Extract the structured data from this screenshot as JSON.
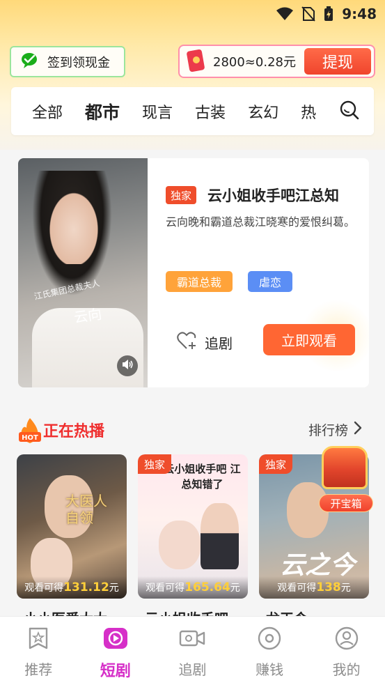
{
  "status_bar": {
    "time": "9:48"
  },
  "checkin": {
    "label": "签到领现金",
    "icon": "wechat-icon"
  },
  "balance": {
    "amount": "2800≈0.28元",
    "withdraw_label": "提现",
    "icon": "red-envelope-icon"
  },
  "category_tabs": [
    {
      "label": "全部",
      "active": false
    },
    {
      "label": "都市",
      "active": true
    },
    {
      "label": "现言",
      "active": false
    },
    {
      "label": "古装",
      "active": false
    },
    {
      "label": "玄幻",
      "active": false
    },
    {
      "label": "热",
      "active": false
    }
  ],
  "featured": {
    "badge": "独家",
    "title": "云小姐收手吧江总知",
    "description": "云向晚和霸道总裁江晓寒的爱恨纠葛。",
    "tags": [
      "霸道总裁",
      "虐恋"
    ],
    "poster_caption_small": "江氏集团总裁夫人",
    "poster_caption_name": "云向",
    "follow_label": "追剧",
    "watch_label": "立即观看",
    "colors": {
      "badge": "#ef4d2b",
      "tag1": "#ffa33a",
      "tag2": "#5b8ef5",
      "watch": "#ff6633"
    }
  },
  "hot_section": {
    "title": "正在热播",
    "rank_label": "排行榜",
    "hot_badge": "HOT",
    "treasure_label": "开宝箱",
    "cards": [
      {
        "badge": "",
        "earn_prefix": "观看可得",
        "earn_value": "131.12",
        "earn_suffix": "元",
        "poster_text": "大医人自领",
        "partial_title": "小小医爱大大"
      },
      {
        "badge": "独家",
        "earn_prefix": "观看可得",
        "earn_value": "165.64",
        "earn_suffix": "元",
        "poster_text": "云小姐收手吧 江总知错了",
        "partial_title": "云小姐收手吧"
      },
      {
        "badge": "独家",
        "earn_prefix": "观看可得",
        "earn_value": "138",
        "earn_suffix": "元",
        "poster_text": "云之今",
        "partial_title": "龙王令"
      }
    ]
  },
  "bottom_nav": [
    {
      "label": "推荐",
      "icon": "recommend-icon",
      "active": false
    },
    {
      "label": "短剧",
      "icon": "short-drama-icon",
      "active": true
    },
    {
      "label": "追剧",
      "icon": "follow-drama-icon",
      "active": false
    },
    {
      "label": "赚钱",
      "icon": "earn-money-icon",
      "active": false
    },
    {
      "label": "我的",
      "icon": "profile-icon",
      "active": false
    }
  ]
}
